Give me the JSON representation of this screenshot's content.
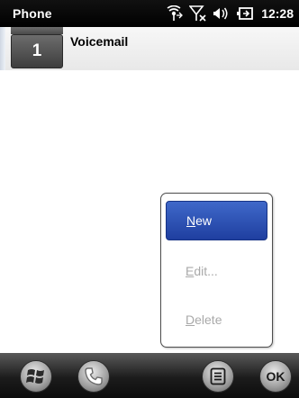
{
  "status_bar": {
    "app_title": "Phone",
    "clock": "12:28",
    "icons": [
      "connectivity-icon",
      "no-signal-icon",
      "speaker-icon",
      "battery-charging-icon"
    ]
  },
  "header": {
    "line_number": "1",
    "title": "Voicemail"
  },
  "popup_menu": {
    "items": [
      {
        "accel": "N",
        "rest": "ew",
        "enabled": true,
        "selected": true
      },
      {
        "accel": "E",
        "rest": "dit...",
        "enabled": false,
        "selected": false
      },
      {
        "accel": "D",
        "rest": "elete",
        "enabled": false,
        "selected": false
      }
    ]
  },
  "softkeys": {
    "ok_label": "OK",
    "icons": [
      "windows-start-icon",
      "phone-icon",
      "menu-icon"
    ]
  },
  "colors": {
    "selection": "#2a4fb8",
    "disabled_text": "#a9a9a9",
    "status_bar": "#000000"
  }
}
